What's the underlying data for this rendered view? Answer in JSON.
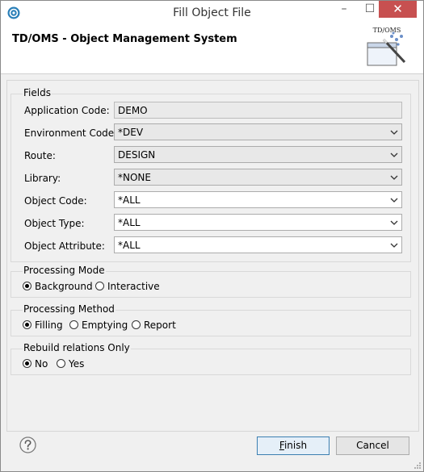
{
  "window": {
    "title": "Fill Object File",
    "min_symbol": "–",
    "max_symbol": "☐",
    "close_symbol": "✕"
  },
  "banner": {
    "title": "TD/OMS - Object Management System",
    "logo_text": "TD/OMS"
  },
  "fields_group": {
    "title": "Fields",
    "rows": [
      {
        "label": "Application Code:",
        "value": "DEMO"
      },
      {
        "label": "Environment Code:",
        "value": "*DEV"
      },
      {
        "label": "Route:",
        "value": "DESIGN"
      },
      {
        "label": "Library:",
        "value": "*NONE"
      },
      {
        "label": "Object Code:",
        "value": "*ALL"
      },
      {
        "label": "Object Type:",
        "value": "*ALL"
      },
      {
        "label": "Object Attribute:",
        "value": "*ALL"
      }
    ]
  },
  "processing_mode": {
    "title": "Processing Mode",
    "options": [
      {
        "label": "Background",
        "selected": true
      },
      {
        "label": "Interactive",
        "selected": false
      }
    ]
  },
  "processing_method": {
    "title": "Processing Method",
    "options": [
      {
        "label": "Filling",
        "selected": true
      },
      {
        "label": "Emptying",
        "selected": false
      },
      {
        "label": "Report",
        "selected": false
      }
    ]
  },
  "rebuild_relations": {
    "title": "Rebuild relations Only",
    "options": [
      {
        "label": "No",
        "selected": true
      },
      {
        "label": "Yes",
        "selected": false
      }
    ]
  },
  "buttons": {
    "finish": "Finish",
    "cancel": "Cancel"
  },
  "icons": {
    "app": "eclipse-app-icon",
    "help": "question-mark-icon",
    "logo": "wand-window-icon"
  }
}
